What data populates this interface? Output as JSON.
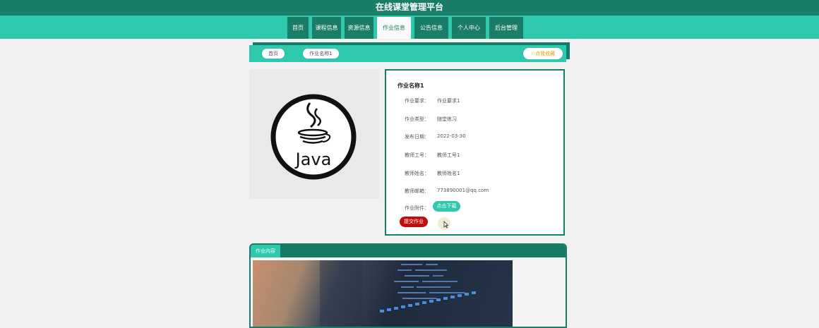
{
  "site": {
    "title": "在线课堂管理平台"
  },
  "nav": {
    "items": [
      {
        "label": "首页",
        "active": false
      },
      {
        "label": "课程信息",
        "active": false
      },
      {
        "label": "资源信息",
        "active": false
      },
      {
        "label": "作业信息",
        "active": true
      },
      {
        "label": "公告信息",
        "active": false
      },
      {
        "label": "个人中心",
        "active": false
      },
      {
        "label": "后台管理",
        "active": false
      }
    ]
  },
  "breadcrumb": {
    "home": "首页",
    "current": "作业名称1",
    "favorite": "☆点我收藏"
  },
  "cover": {
    "logo_text": "Java"
  },
  "detail": {
    "title": "作业名称1",
    "rows": [
      {
        "label": "作业要求：",
        "value": "作业要求1"
      },
      {
        "label": "作业类型：",
        "value": "随堂练习"
      },
      {
        "label": "发布日期：",
        "value": "2022-03-30"
      },
      {
        "label": "教师工号：",
        "value": "教师工号1"
      },
      {
        "label": "教师姓名：",
        "value": "教师姓名1"
      },
      {
        "label": "教师邮箱：",
        "value": "773890001@qq.com"
      }
    ],
    "attachment_label": "作业附件：",
    "download_label": "点击下载",
    "submit_label": "提交作业"
  },
  "content": {
    "tab_label": "作业内容"
  },
  "colors": {
    "dark_green": "#1a7d68",
    "teal": "#2ec8ad",
    "red": "#c20d0d",
    "gold": "#e6a100"
  }
}
